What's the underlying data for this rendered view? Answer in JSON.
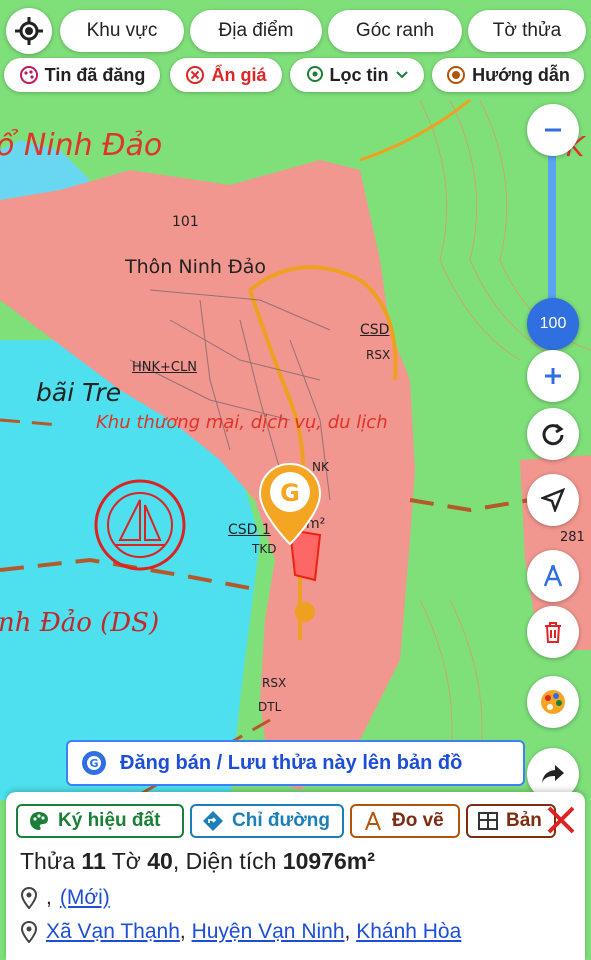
{
  "top_tabs": [
    "Khu vực",
    "Địa điểm",
    "Góc ranh",
    "Tờ thửa"
  ],
  "filters": {
    "posted": "Tin đã đăng",
    "hide_price": "Ẩn giá",
    "filter": "Lọc tin",
    "guide": "Hướng dẫn"
  },
  "zoom": {
    "level": "100"
  },
  "map_labels": {
    "ninh_dao": "ổ Ninh Đảo",
    "elevation_101": "101",
    "thon_ninh_dao": "Thôn Ninh Đảo",
    "csd": "CSD",
    "rsx": "RSX",
    "hnk_cln": "HNK+CLN",
    "bai_tre": "bãi Tre",
    "commercial": "Khu thương mại, dịch vụ, du lịch",
    "nk": "NK",
    "csd_area": "CSD 1",
    "m2": "m²",
    "tkd": "TKD",
    "ninh_dao_ds": "nh Đảo (DS)",
    "rsx2": "RSX",
    "dtl": "DTL",
    "elevation_281": "281",
    "corner_k": "K"
  },
  "post_banner": "Đăng bán / Lưu thửa này lên bản đồ",
  "panel": {
    "chips": [
      "Ký hiệu đất",
      "Chỉ đường",
      "Đo vẽ",
      "Bản"
    ],
    "parcel": {
      "thua_label": "Thửa",
      "thua": "11",
      "to_label": "Tờ",
      "to": "40",
      "area_label": "Diện tích",
      "area": "10976m²"
    },
    "address_prefix": ",",
    "address_new": "(Mới)",
    "commune": "Xã Vạn Thạnh",
    "district": "Huyện Vạn Ninh",
    "province": "Khánh Hòa",
    "sep": ","
  },
  "colors": {
    "land_pink": "#f2978f",
    "green": "#7fe07a",
    "sea": "#4ee0ee",
    "marker": "#f4a623",
    "accent_blue": "#2f6fe0"
  }
}
